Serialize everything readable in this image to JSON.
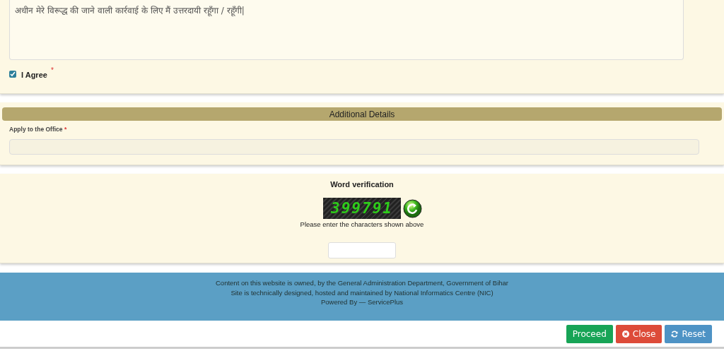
{
  "declaration": {
    "text": "अधीन मेरे विरूद्ध की जाने वाली कार्रवाई के लिए मैं उत्तरदायी रहूँगा / रहूँगी|"
  },
  "agree": {
    "label": "I Agree",
    "checked": true,
    "required": "*"
  },
  "additional_details": {
    "title": "Additional Details",
    "field_label": "Apply to the Office",
    "required": "*"
  },
  "word_verification": {
    "title": "Word verification",
    "captcha": "399791",
    "hint": "Please enter the characters shown above"
  },
  "footer": {
    "lines": [
      "Content on this website is owned, by the General Administration Department, Government of Bihar",
      "Site is technically designed, hosted and maintained by National Informatics Centre (NIC)",
      "Powered By — ServicePlus"
    ]
  },
  "buttons": [
    {
      "kind": "proceed",
      "label": "Proceed"
    },
    {
      "kind": "close",
      "label": "Close"
    },
    {
      "kind": "reset",
      "label": "Reset"
    }
  ]
}
